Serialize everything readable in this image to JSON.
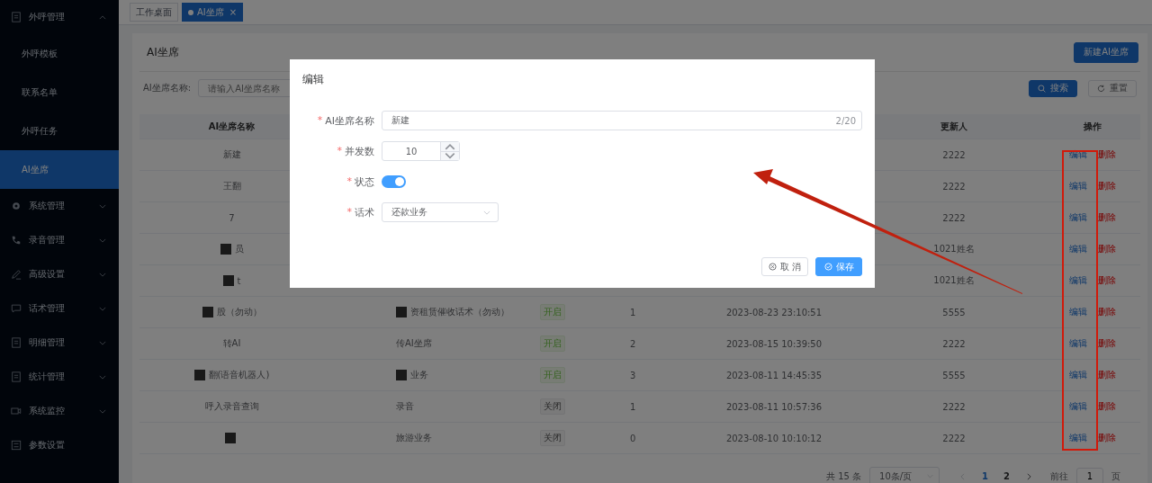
{
  "sidebar": {
    "items": [
      {
        "label": "外呼管理",
        "expanded": true,
        "children": [
          {
            "label": "外呼模板",
            "selected": false
          },
          {
            "label": "联系名单",
            "selected": false
          },
          {
            "label": "外呼任务",
            "selected": false
          },
          {
            "label": "AI坐席",
            "selected": true
          }
        ]
      },
      {
        "label": "系统管理",
        "expanded": false
      },
      {
        "label": "录音管理",
        "expanded": false
      },
      {
        "label": "高级设置",
        "expanded": false
      },
      {
        "label": "话术管理",
        "expanded": false
      },
      {
        "label": "明细管理",
        "expanded": false
      },
      {
        "label": "统计管理",
        "expanded": false
      },
      {
        "label": "系统监控",
        "expanded": false
      },
      {
        "label": "参数设置"
      }
    ]
  },
  "tabs": [
    {
      "label": "工作桌面",
      "selected": false
    },
    {
      "label": "AI坐席",
      "selected": true,
      "close": "×"
    }
  ],
  "page": {
    "title": "AI坐席",
    "new_button": "新建AI坐席"
  },
  "search": {
    "label": "AI坐席名称:",
    "placeholder": "请输入AI坐席名称",
    "search_button": "搜索",
    "reset_button": "重置"
  },
  "table": {
    "columns": [
      {
        "label": "AI坐席名称"
      },
      {},
      {},
      {},
      {},
      {
        "label": "更新人"
      },
      {
        "label": "操作"
      }
    ],
    "rows": [
      {
        "name": "新建",
        "updater": "2222",
        "actions": [
          {
            "label": "编辑",
            "kind": "edit"
          },
          {
            "label": "删除",
            "kind": "delete"
          }
        ]
      },
      {
        "name": "王翻",
        "updater": "2222",
        "actions": [
          {
            "label": "编辑",
            "kind": "edit"
          },
          {
            "label": "删除",
            "kind": "delete"
          }
        ]
      },
      {
        "name": "7",
        "updater": "2222",
        "actions": [
          {
            "label": "编辑",
            "kind": "edit"
          },
          {
            "label": "删除",
            "kind": "delete"
          }
        ]
      },
      {
        "name": "员",
        "name_redacted": true,
        "updater": "1021姓名",
        "actions": [
          {
            "label": "编辑",
            "kind": "edit"
          },
          {
            "label": "删除",
            "kind": "delete"
          }
        ]
      },
      {
        "name": "t",
        "name_redacted": true,
        "updater": "1021姓名",
        "actions": [
          {
            "label": "编辑",
            "kind": "edit"
          },
          {
            "label": "删除",
            "kind": "delete"
          }
        ]
      },
      {
        "name": "股（勿动）",
        "name_redacted": true,
        "script": "资租赁催收话术（勿动）",
        "script_redacted": true,
        "status": {
          "label": "开启",
          "on": true
        },
        "count": "1",
        "time": "2023-08-23 23:10:51",
        "updater": "5555",
        "actions": [
          {
            "label": "编辑",
            "kind": "edit"
          },
          {
            "label": "删除",
            "kind": "delete"
          }
        ]
      },
      {
        "name": "转AI",
        "script": "传AI坐席",
        "status": {
          "label": "开启",
          "on": true
        },
        "count": "2",
        "time": "2023-08-15 10:39:50",
        "updater": "2222",
        "actions": [
          {
            "label": "编辑",
            "kind": "edit"
          },
          {
            "label": "删除",
            "kind": "delete"
          }
        ]
      },
      {
        "name": "翻(语音机器人)",
        "name_redacted": true,
        "script": "业务",
        "script_redacted": true,
        "status": {
          "label": "开启",
          "on": true
        },
        "count": "3",
        "time": "2023-08-11 14:45:35",
        "updater": "5555",
        "actions": [
          {
            "label": "编辑",
            "kind": "edit"
          },
          {
            "label": "删除",
            "kind": "delete"
          }
        ]
      },
      {
        "name": "呼入录音查询",
        "script": "录音",
        "status": {
          "label": "关闭",
          "on": false
        },
        "count": "1",
        "time": "2023-08-11 10:57:36",
        "updater": "2222",
        "actions": [
          {
            "label": "编辑",
            "kind": "edit"
          },
          {
            "label": "删除",
            "kind": "delete"
          }
        ]
      },
      {
        "name_redacted": true,
        "script": "旅游业务",
        "status": {
          "label": "关闭",
          "on": false
        },
        "count": "0",
        "time": "2023-08-10 10:10:12",
        "updater": "2222",
        "actions": [
          {
            "label": "编辑",
            "kind": "edit"
          },
          {
            "label": "删除",
            "kind": "delete"
          }
        ]
      }
    ]
  },
  "pagination": {
    "total": "共 15 条",
    "page_size": "10条/页",
    "pages": [
      {
        "label": "1",
        "selected": true
      },
      {
        "label": "2",
        "selected": false
      }
    ],
    "goto_label": "前往",
    "goto_value": "1",
    "goto_suffix": "页"
  },
  "dialog": {
    "title": "编辑",
    "fields": [
      {
        "kind": "text",
        "label": "AI坐席名称",
        "required": "*",
        "value": "新建",
        "counter": "2/20"
      },
      {
        "kind": "number",
        "label": "并发数",
        "required": "*",
        "value": "10"
      },
      {
        "kind": "switch",
        "label": "状态",
        "required": "*",
        "on": true
      },
      {
        "kind": "select",
        "label": "话术",
        "required": "*",
        "value": "还款业务"
      }
    ],
    "cancel_button": "取 消",
    "save_button": "保存"
  }
}
